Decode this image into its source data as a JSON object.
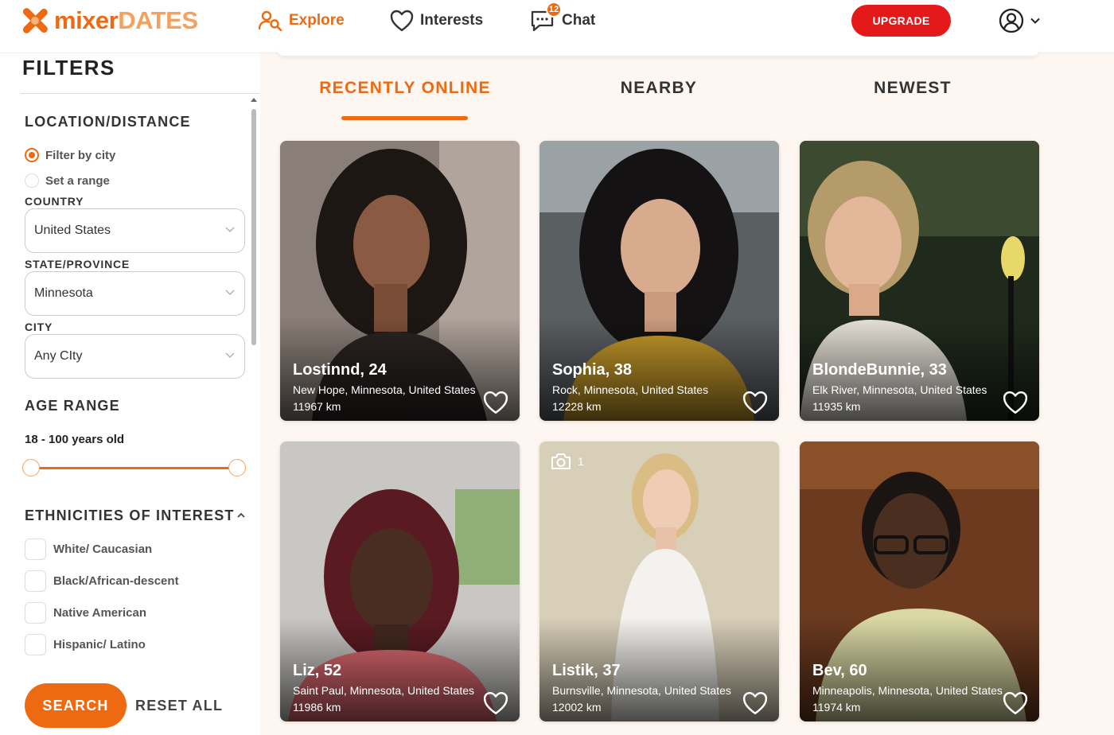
{
  "brand": {
    "mixer": "mixer",
    "dates": "DATES",
    "accent": "#ee6a12",
    "upgrade_color": "#e41a1a"
  },
  "nav": {
    "explore": "Explore",
    "interests": "Interests",
    "chat": "Chat",
    "chat_badge": "12",
    "upgrade": "UPGRADE"
  },
  "filters": {
    "title": "FILTERS",
    "location_title": "LOCATION/DISTANCE",
    "filter_by_city": "Filter by city",
    "set_range": "Set a range",
    "country_label": "COUNTRY",
    "country_value": "United States",
    "state_label": "STATE/PROVINCE",
    "state_value": "Minnesota",
    "city_label": "CITY",
    "city_value": "Any CIty",
    "age_title": "AGE RANGE",
    "age_text": "18 - 100 years old",
    "ethnicity_title": "ETHNICITIES OF INTEREST",
    "ethnicities": [
      "White/ Caucasian",
      "Black/African-descent",
      "Native American",
      "Hispanic/ Latino"
    ],
    "search": "SEARCH",
    "reset": "RESET ALL"
  },
  "tabs": [
    "RECENTLY ONLINE",
    "NEARBY",
    "NEWEST"
  ],
  "profiles": [
    {
      "name": "Lostinnd, 24",
      "location": "New Hope, Minnesota, United States",
      "distance": "11967 km"
    },
    {
      "name": "Sophia, 38",
      "location": "Rock, Minnesota, United States",
      "distance": "12228 km"
    },
    {
      "name": "BlondeBunnie, 33",
      "location": "Elk River, Minnesota, United States",
      "distance": "11935 km"
    },
    {
      "name": "Liz, 52",
      "location": "Saint Paul, Minnesota, United States",
      "distance": "11986 km"
    },
    {
      "name": "Listik, 37",
      "location": "Burnsville, Minnesota, United States",
      "distance": "12002 km",
      "photo_count": "1"
    },
    {
      "name": "Bev, 60",
      "location": "Minneapolis, Minnesota, United States",
      "distance": "11974 km"
    }
  ]
}
